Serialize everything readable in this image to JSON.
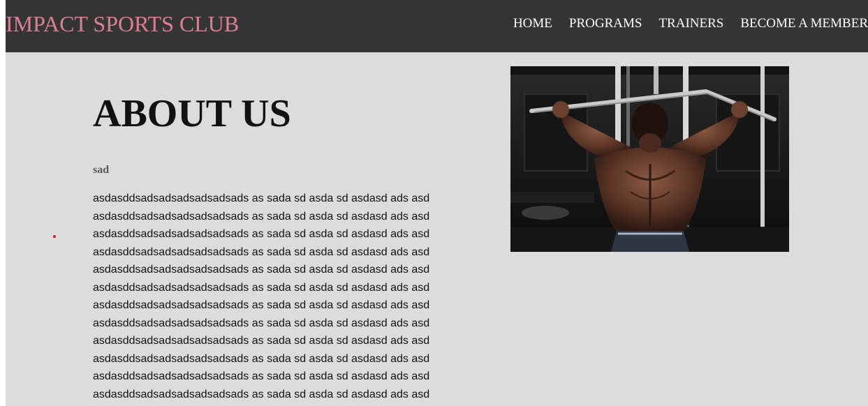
{
  "header": {
    "brand": "IMPACT SPORTS CLUB",
    "brand_color": "#d98095",
    "background": "#353535",
    "nav": [
      {
        "label": "HOME"
      },
      {
        "label": "PROGRAMS"
      },
      {
        "label": "TRAINERS"
      },
      {
        "label": "BECOME A MEMBER"
      }
    ]
  },
  "main": {
    "background": "#dcdcdc",
    "title": "ABOUT US",
    "subtitle": "sad",
    "body_lines": [
      "asdasddsadsadsadsadsadsads as sada sd asda sd asdasd ads asd",
      "asdasddsadsadsadsadsadsads as sada sd asda sd asdasd ads asd",
      "asdasddsadsadsadsadsadsads as sada sd asda sd asdasd ads asd",
      "asdasddsadsadsadsadsadsads as sada sd asda sd asdasd ads asd",
      "asdasddsadsadsadsadsadsads as sada sd asda sd asdasd ads asd",
      "asdasddsadsadsadsadsadsads as sada sd asda sd asdasd ads asd",
      "asdasddsadsadsadsadsadsads as sada sd asda sd asdasd ads asd",
      "asdasddsadsadsadsadsadsads as sada sd asda sd asdasd ads asd",
      "asdasddsadsadsadsadsadsads as sada sd asda sd asdasd ads asd",
      "asdasddsadsadsadsadsadsads as sada sd asda sd asdasd ads asd",
      "asdasddsadsadsadsadsadsads as sada sd asda sd asdasd ads asd",
      "asdasddsadsadsadsadsadsads as sada sd asda sd asdasd ads asd"
    ],
    "image": {
      "name": "gym-lat-pulldown-photo"
    }
  }
}
